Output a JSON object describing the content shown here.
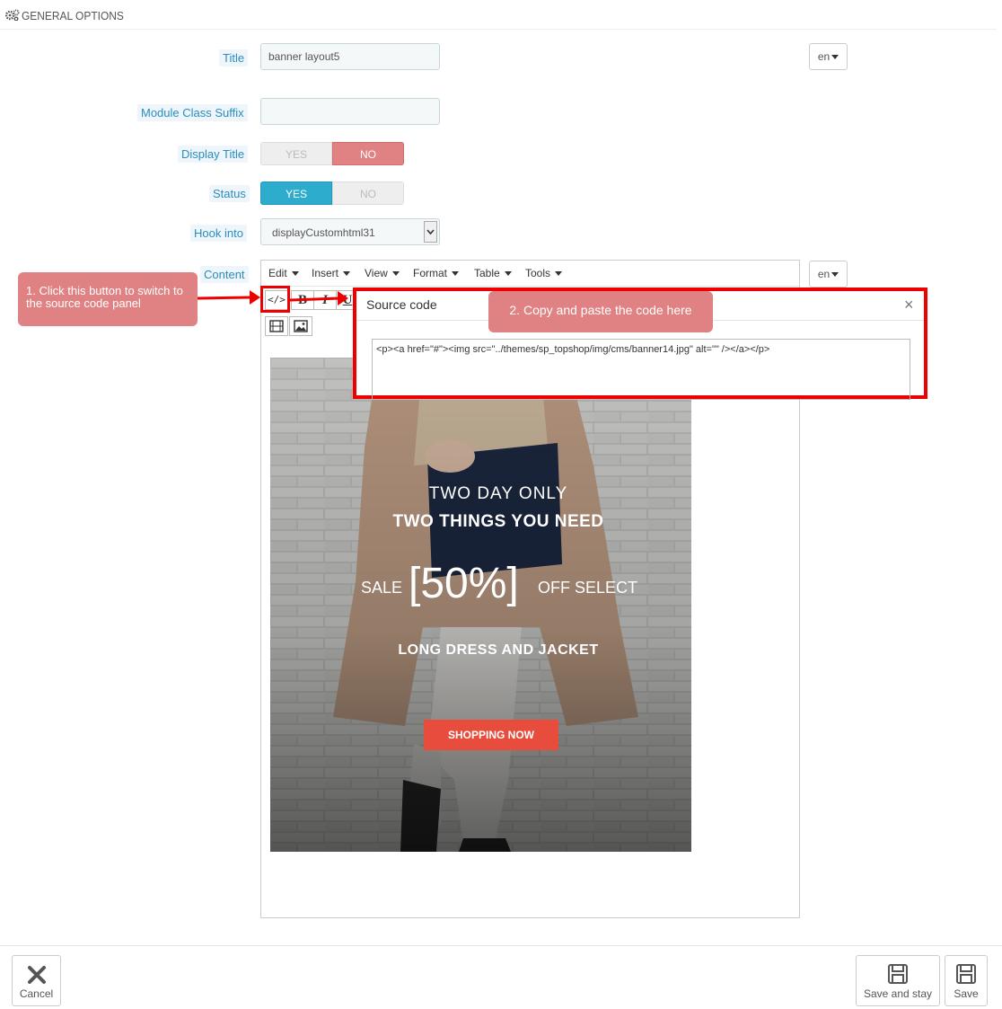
{
  "header": {
    "title": "GENERAL OPTIONS",
    "icon": "gears-icon"
  },
  "form": {
    "title_label": "Title",
    "title_value": "banner layout5",
    "lang": "en",
    "suffix_label": "Module Class Suffix",
    "suffix_value": "",
    "display_title_label": "Display Title",
    "status_label": "Status",
    "yes": "YES",
    "no": "NO",
    "hook_label": "Hook into",
    "hook_value": "displayCustomhtml31",
    "content_label": "Content"
  },
  "editor": {
    "menus": [
      "Edit",
      "Insert",
      "View",
      "Format",
      "Table",
      "Tools"
    ],
    "bold": "B",
    "italic": "I",
    "underline": "U",
    "lang": "en"
  },
  "banner": {
    "line1": "TWO DAY ONLY",
    "line2": "TWO THINGS YOU NEED",
    "sale": "SALE",
    "percent": "[50%]",
    "off": "OFF SELECT",
    "line4": "LONG DRESS AND JACKET",
    "cta": "SHOPPING NOW"
  },
  "dialog": {
    "title": "Source code",
    "close": "×",
    "code": "<p><a href=\"#\"><img src=\"../themes/sp_topshop/img/cms/banner14.jpg\" alt=\"\" /></a></p>"
  },
  "callouts": {
    "step1": "1. Click this button to switch to the source code panel",
    "step2": "2. Copy and paste the code here"
  },
  "footer": {
    "cancel": "Cancel",
    "save_stay": "Save and stay",
    "save": "Save"
  },
  "colors": {
    "link": "#2b8cbe",
    "no": "#e08283",
    "yes": "#2eacce",
    "highlight": "#ee0000",
    "cta": "#e74c3c"
  }
}
